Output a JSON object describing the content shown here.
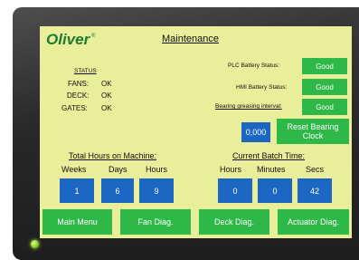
{
  "brand": {
    "logo": "Oliver",
    "logo_mark": "®"
  },
  "screen": {
    "title": "Maintenance"
  },
  "status": {
    "heading": "STATUS",
    "rows": [
      {
        "label": "FANS:",
        "value": "OK"
      },
      {
        "label": "DECK:",
        "value": "OK"
      },
      {
        "label": "GATES:",
        "value": "OK"
      }
    ]
  },
  "battery": {
    "plc_label": "PLC Battery Status:",
    "plc_value": "Good",
    "hmi_label": "HMI Battery Status:",
    "hmi_value": "Good",
    "grease_label": "Bearing greasing interval:",
    "grease_value": "Good"
  },
  "bearing_clock": {
    "value": "0,000",
    "reset_label": "Reset Bearing Clock"
  },
  "total_hours": {
    "heading": "Total Hours on Machine:",
    "columns": [
      "Weeks",
      "Days",
      "Hours"
    ],
    "values": [
      "1",
      "6",
      "9"
    ]
  },
  "batch_time": {
    "heading": "Current Batch Time:",
    "columns": [
      "Hours",
      "Minutes",
      "Secs"
    ],
    "values": [
      "0",
      "0",
      "42"
    ]
  },
  "nav": {
    "main_menu": "Main Menu",
    "fan_diag": "Fan Diag.",
    "deck_diag": "Deck Diag.",
    "actuator_diag": "Actuator Diag."
  },
  "colors": {
    "screen_bg": "#e8ee9a",
    "button_green": "#2eb848",
    "value_blue": "#1c66c4",
    "logo_green": "#1d7a2f"
  }
}
